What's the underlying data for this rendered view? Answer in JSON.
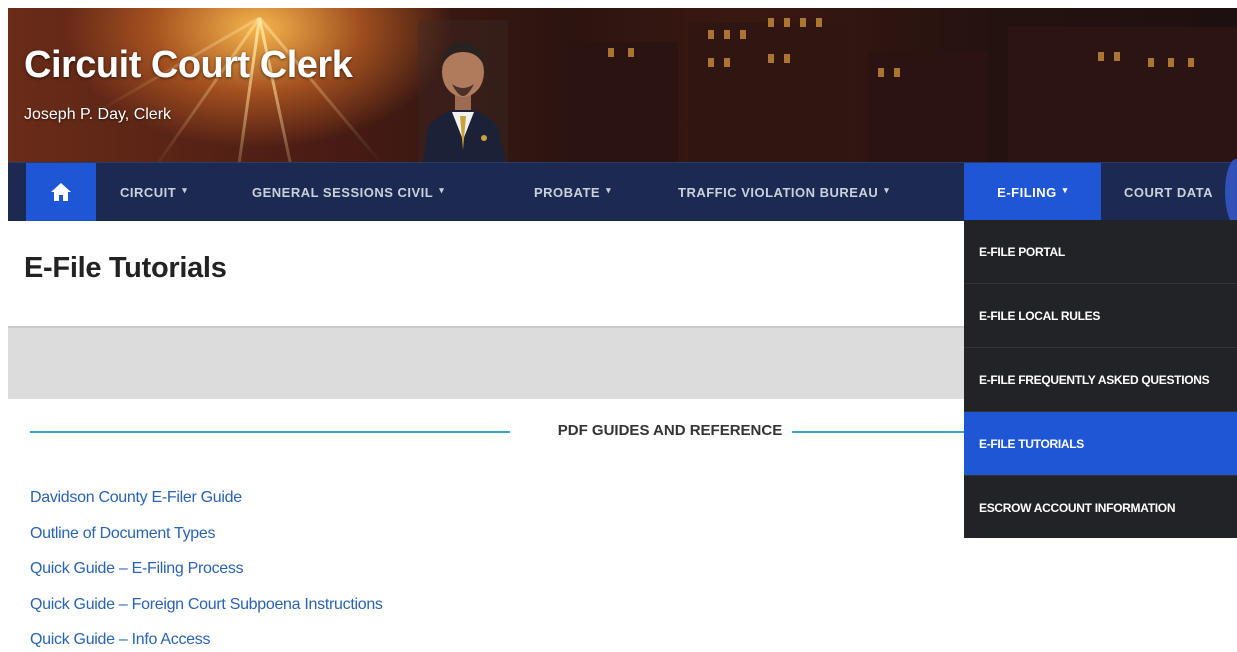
{
  "header": {
    "title": "Circuit Court Clerk",
    "subtitle": "Joseph P. Day, Clerk"
  },
  "nav": {
    "home_icon": "home-icon",
    "items": [
      {
        "label": "CIRCUIT"
      },
      {
        "label": "GENERAL SESSIONS CIVIL"
      },
      {
        "label": "PROBATE"
      },
      {
        "label": "TRAFFIC VIOLATION BUREAU"
      },
      {
        "label": "E-FILING",
        "active": true
      },
      {
        "label": "COURT DATA"
      }
    ],
    "caret": "▾"
  },
  "dropdown": {
    "items": [
      {
        "label": "E-FILE PORTAL"
      },
      {
        "label": "E-FILE LOCAL RULES"
      },
      {
        "label": "E-FILE FREQUENTLY ASKED QUESTIONS"
      },
      {
        "label": "E-FILE TUTORIALS",
        "active": true
      },
      {
        "label": "ESCROW ACCOUNT INFORMATION"
      }
    ]
  },
  "page": {
    "title": "E-File Tutorials",
    "section_heading": "PDF GUIDES AND REFERENCE",
    "links": [
      "Davidson County E-Filer Guide",
      "Outline of Document Types",
      "Quick Guide – E-Filing Process",
      "Quick Guide – Foreign Court Subpoena Instructions",
      "Quick Guide – Info Access"
    ]
  },
  "colors": {
    "nav_bg": "#1c2a52",
    "accent_blue": "#1e56d6",
    "dropdown_bg": "#222327",
    "link": "#2a63b4",
    "divider": "#34a6c4"
  }
}
